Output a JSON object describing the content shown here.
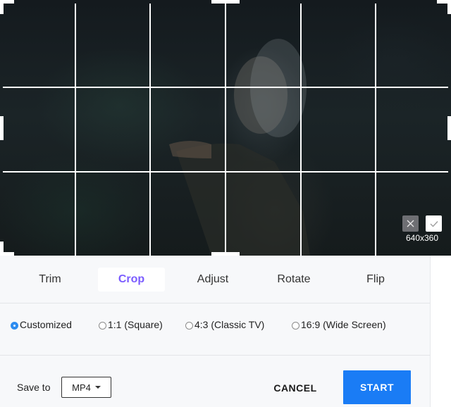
{
  "video": {
    "dimensions": "640x360"
  },
  "tabs": [
    {
      "label": "Trim"
    },
    {
      "label": "Crop",
      "active": true
    },
    {
      "label": "Adjust"
    },
    {
      "label": "Rotate"
    },
    {
      "label": "Flip"
    }
  ],
  "ratios": [
    {
      "label": "Customized",
      "selected": true
    },
    {
      "label": "1:1 (Square)"
    },
    {
      "label": "4:3 (Classic TV)"
    },
    {
      "label": "16:9 (Wide Screen)"
    }
  ],
  "bottom": {
    "save_label": "Save to",
    "format": "MP4",
    "cancel_label": "CANCEL",
    "start_label": "START"
  },
  "colors": {
    "accent": "#7b5cff",
    "primary_button": "#1a7cf5",
    "radio_selected": "#2d8cf0"
  },
  "icons": {
    "cancel_crop": "close-icon",
    "confirm_crop": "check-icon",
    "format_caret": "caret-down-icon"
  }
}
